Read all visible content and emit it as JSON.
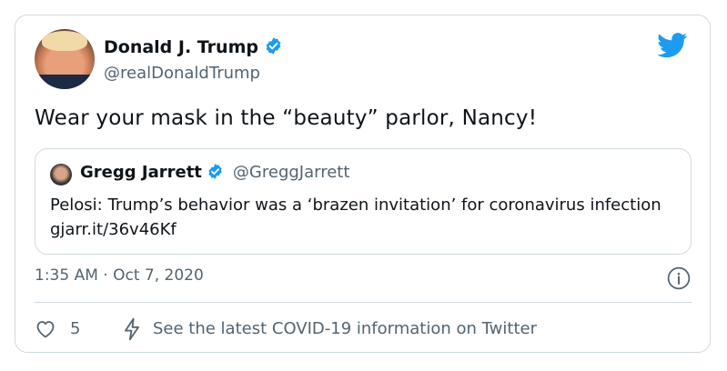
{
  "tweet": {
    "author": {
      "name": "Donald J. Trump",
      "handle": "@realDonaldTrump",
      "verified": true
    },
    "text": "Wear your mask in the “beauty” parlor, Nancy!",
    "timestamp": "1:35 AM · Oct 7, 2020",
    "like_count": "5",
    "covid_notice": "See the latest COVID-19 information on Twitter"
  },
  "quoted_tweet": {
    "author": {
      "name": "Gregg Jarrett",
      "handle": "@GreggJarrett",
      "verified": true
    },
    "text": "Pelosi: Trump’s behavior was a ‘brazen invitation’ for coronavirus infection gjarr.it/36v46Kf"
  },
  "icons": {
    "logo": "twitter-bird-icon",
    "verified": "verified-badge-icon",
    "info": "info-icon",
    "like": "heart-icon",
    "notice": "lightning-bolt-icon"
  },
  "colors": {
    "accent": "#1d9bf0",
    "secondary_text": "#536471",
    "border": "#cfd9de"
  }
}
